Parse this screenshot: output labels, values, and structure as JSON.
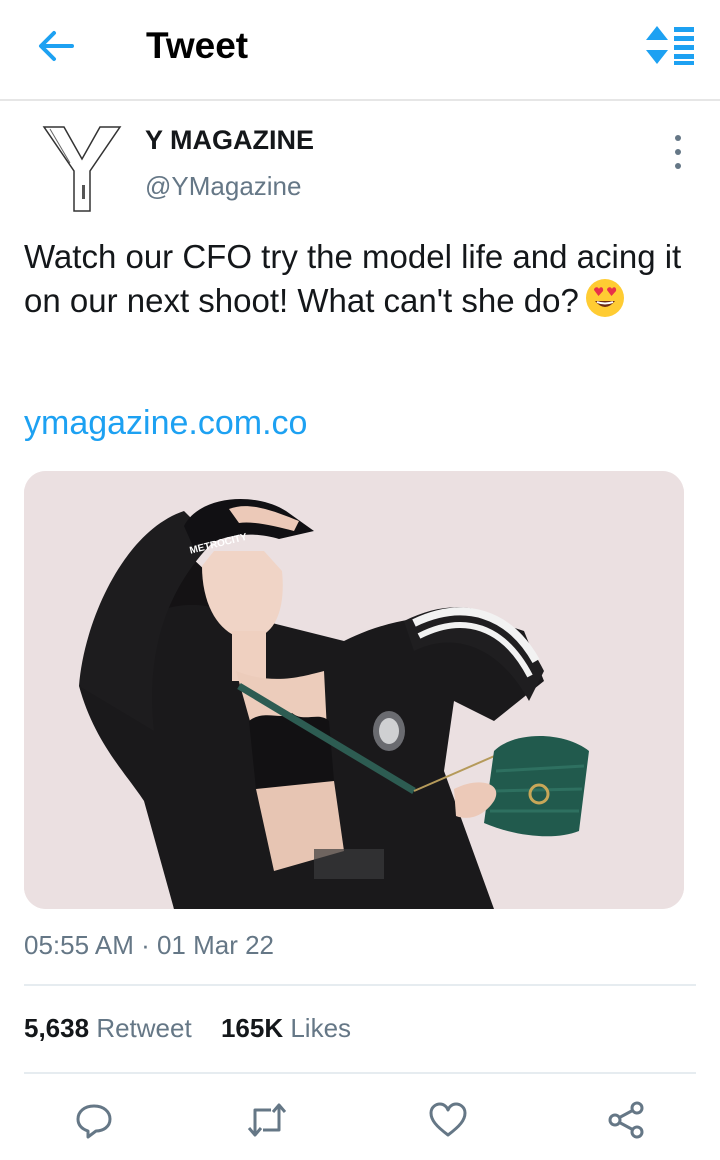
{
  "header": {
    "title": "Tweet",
    "back_icon": "arrow-left-icon",
    "sort_icon": "sort-list-icon",
    "accent_color": "#1da1f2"
  },
  "author": {
    "name": "Y MAGAZINE",
    "handle": "@YMagazine",
    "avatar_icon": "y-logo-avatar",
    "more_icon": "more-vertical-icon"
  },
  "tweet": {
    "text": "Watch our CFO try the model life and acing it on our next shoot! What can't she do?",
    "emoji": "heart-eyes-emoji",
    "link": "ymagazine.com.co",
    "photo_cap_text": "METROCITY",
    "timestamp": "05:55 AM · 01 Mar 22"
  },
  "stats": {
    "retweets_count": "5,638",
    "retweets_label": "Retweet",
    "likes_count": "165K",
    "likes_label": "Likes"
  },
  "actions": [
    {
      "name": "reply",
      "icon": "reply-icon"
    },
    {
      "name": "retweet",
      "icon": "retweet-icon"
    },
    {
      "name": "like",
      "icon": "heart-icon"
    },
    {
      "name": "share",
      "icon": "share-icon"
    }
  ]
}
